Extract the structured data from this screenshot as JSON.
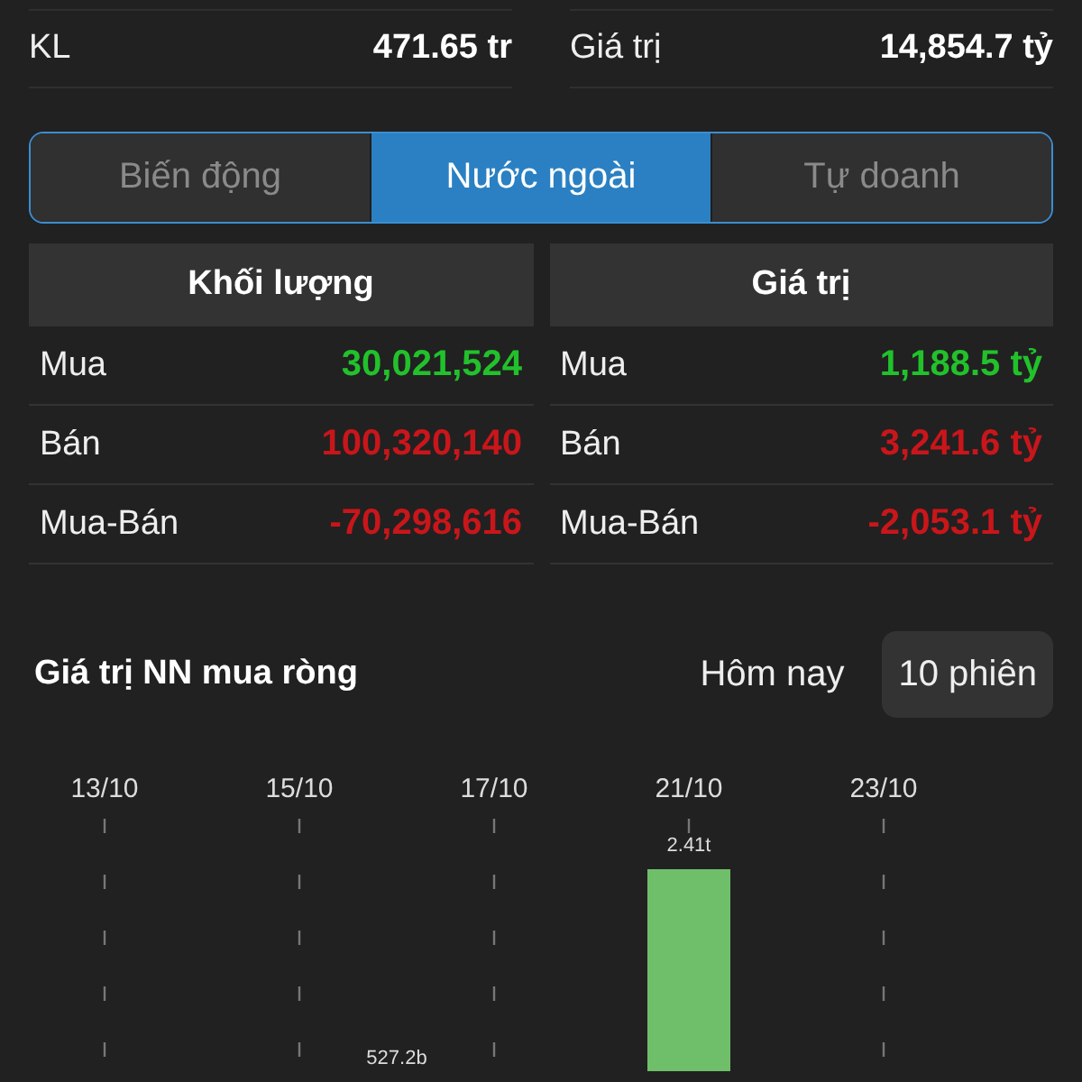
{
  "summary": [
    {
      "label": "KL",
      "value": "471.65 tr"
    },
    {
      "label": "Giá trị",
      "value": "14,854.7 tỷ"
    }
  ],
  "tabs": [
    {
      "label": "Biến động",
      "selected": false
    },
    {
      "label": "Nước ngoài",
      "selected": true
    },
    {
      "label": "Tự doanh",
      "selected": false
    }
  ],
  "tables": [
    {
      "title": "Khối lượng",
      "rows": [
        {
          "label": "Mua",
          "value": "30,021,524",
          "color": "#22c12b"
        },
        {
          "label": "Bán",
          "value": "100,320,140",
          "color": "#c8161b"
        },
        {
          "label": "Mua-Bán",
          "value": "-70,298,616",
          "color": "#c8161b"
        }
      ]
    },
    {
      "title": "Giá trị",
      "rows": [
        {
          "label": "Mua",
          "value": "1,188.5 tỷ",
          "color": "#22c12b"
        },
        {
          "label": "Bán",
          "value": "3,241.6 tỷ",
          "color": "#c8161b"
        },
        {
          "label": "Mua-Bán",
          "value": "-2,053.1 tỷ",
          "color": "#c8161b"
        }
      ]
    }
  ],
  "net_section": {
    "title": "Giá trị NN mua ròng",
    "periods": [
      {
        "label": "Hôm nay",
        "selected": false
      },
      {
        "label": "10 phiên",
        "selected": true
      }
    ],
    "date_labels": [
      "13/10",
      "15/10",
      "17/10",
      "21/10",
      "23/10"
    ],
    "bar_labels": [
      "527.2b",
      "2.41t"
    ]
  }
}
